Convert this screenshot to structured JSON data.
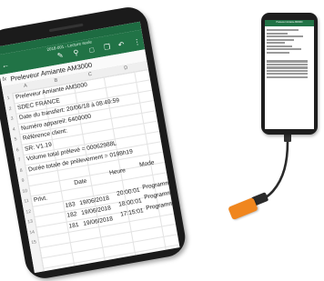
{
  "big_phone": {
    "title_bar": "2018-001 - Lecture seule",
    "icons": [
      "pen-icon",
      "search-icon",
      "share-icon",
      "copy-icon",
      "undo-icon",
      "more-icon"
    ],
    "formula": {
      "fx": "fx",
      "value": "Preleveur Amiante AM3000"
    },
    "columns": [
      "A",
      "B",
      "C",
      "D"
    ],
    "row_numbers": [
      "1",
      "2",
      "3",
      "4",
      "5",
      "6",
      "7",
      "8",
      "9",
      "10",
      "11",
      "12",
      "13",
      "14",
      "15"
    ],
    "cells": {
      "r1": "Preleveur Amiante AM3000",
      "r2": "SDEC FRANCE",
      "r3": "Date du transfert: 20/06/18 à 08:49:59",
      "r4": "Numéro appareil: 6400000",
      "r5": "Référence client:",
      "r6": "SR: V1.19",
      "r7": "Volume total prélevé = 00062988L",
      "r8": "Durée totale de prélevement = 0198h19",
      "hdr_prlvt": "Prlvt.",
      "hdr_date": "Date",
      "hdr_heure": "Heure",
      "hdr_mode": "Mode",
      "rows": [
        {
          "n": "183",
          "date": "19/06/2018",
          "heure": "20:00:01",
          "mode": "Programme"
        },
        {
          "n": "182",
          "date": "19/06/2018",
          "heure": "18:00:01",
          "mode": "Programme"
        },
        {
          "n": "181",
          "date": "19/06/2018",
          "heure": "17:15:01",
          "mode": "Programme"
        }
      ]
    }
  },
  "small_phone": {
    "title_bar": "Preleveur Amiante AM3000"
  },
  "colors": {
    "excel_green": "#217346",
    "sensor_orange": "#f0861e",
    "phone_black": "#1b1b1b"
  }
}
